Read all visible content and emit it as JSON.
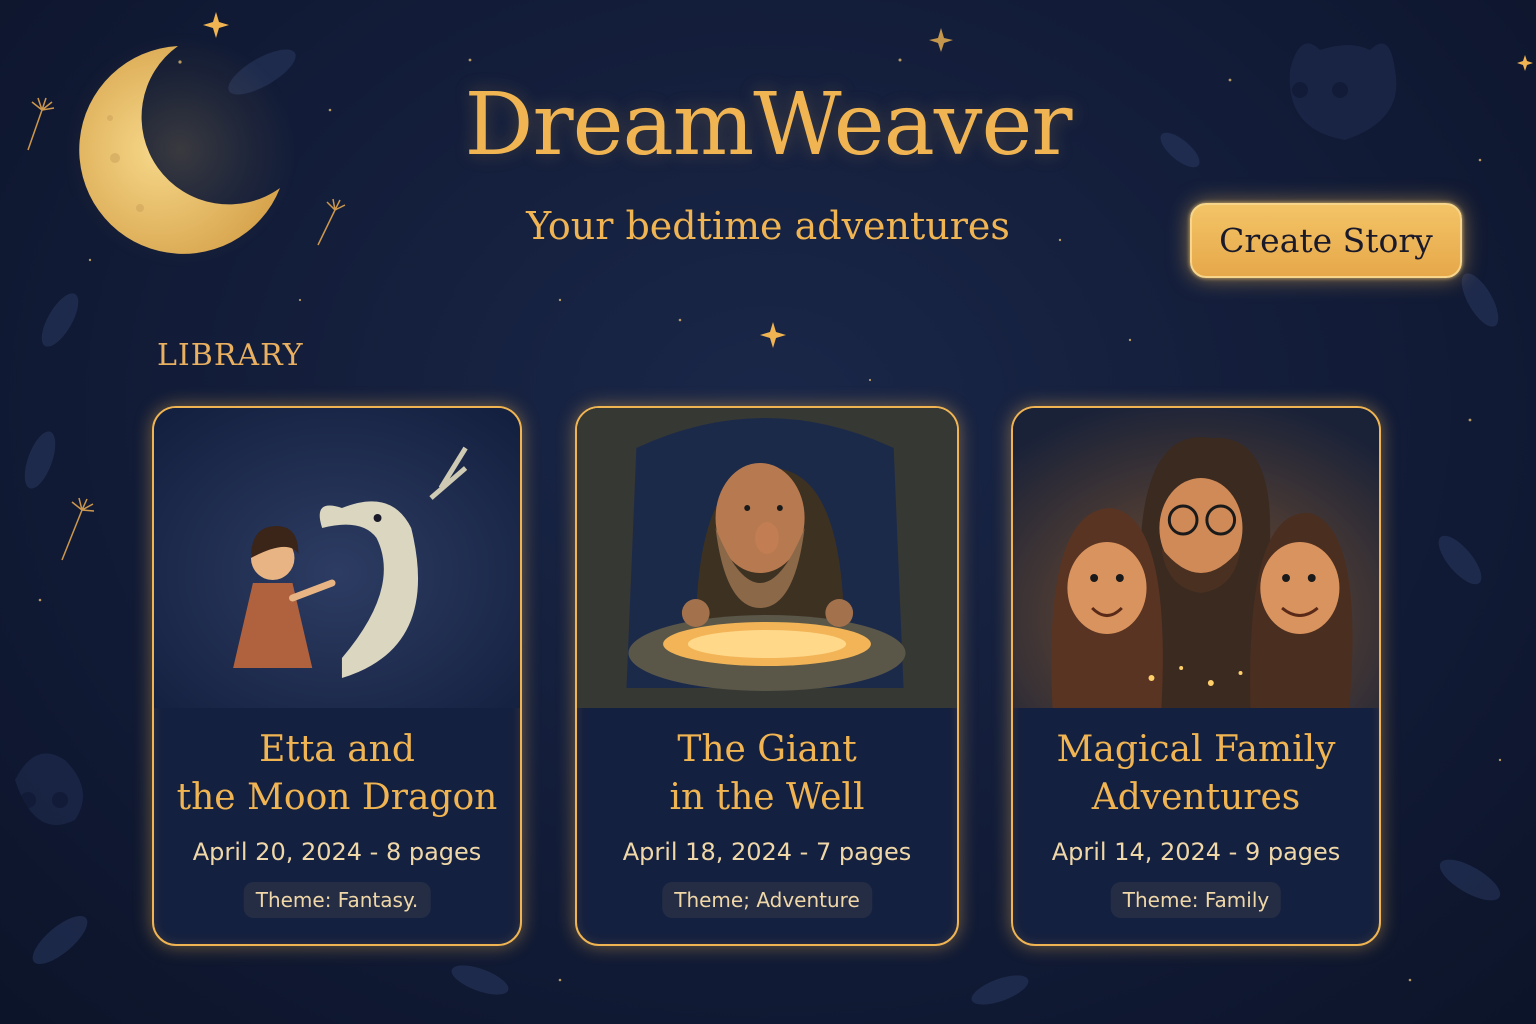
{
  "header": {
    "title": "DreamWeaver",
    "subtitle": "Your bedtime adventures",
    "create_button_label": "Create Story"
  },
  "library": {
    "label": "LIBRARY",
    "stories": [
      {
        "title": "Etta and\nthe Moon Dragon",
        "meta": "April 20, 2024 -  8 pages",
        "theme": "Theme: Fantasy."
      },
      {
        "title": "The Giant\nin the Well",
        "meta": "April 18, 2024 - 7 pages",
        "theme": "Theme; Adventure"
      },
      {
        "title": "Magical Family\nAdventures",
        "meta": "April 14, 2024 - 9 pages",
        "theme": "Theme: Family"
      }
    ]
  },
  "colors": {
    "background": "#121c38",
    "accent": "#f0b552",
    "button_fill": "#eab255",
    "text_light": "#efd7a8"
  },
  "icons": [
    "crescent-moon-icon",
    "star-icon",
    "dandelion-seed-icon"
  ]
}
